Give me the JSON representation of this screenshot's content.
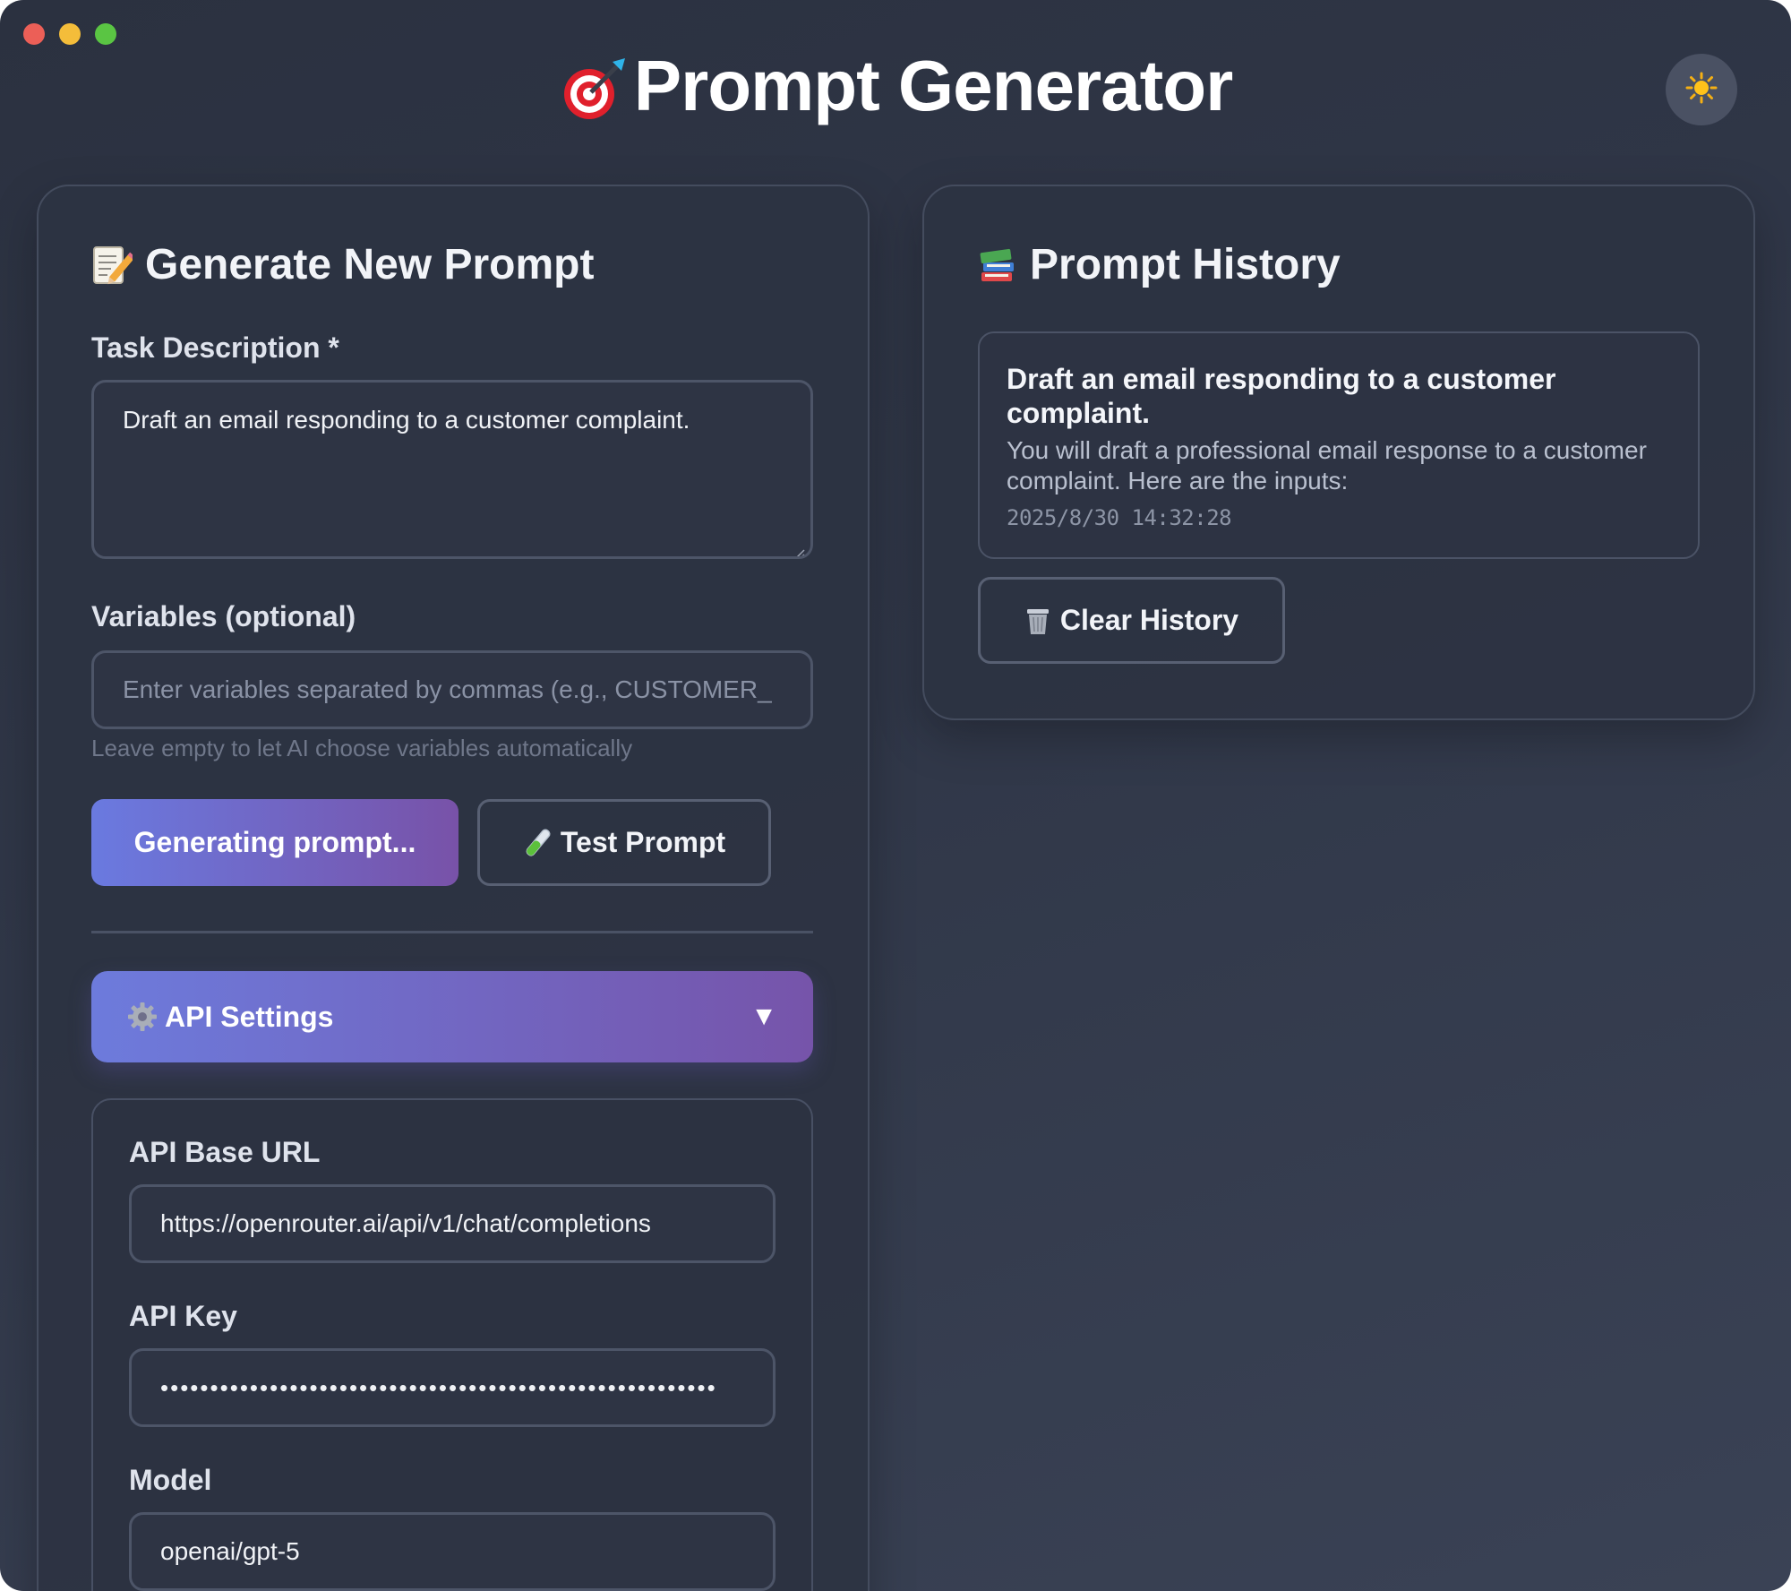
{
  "app": {
    "title": "Prompt Generator",
    "theme_icon": "sun-icon",
    "accent_gradient": [
      "#6a7ae0",
      "#7852a8"
    ]
  },
  "generate": {
    "heading": "Generate New Prompt",
    "heading_icon": "memo-icon",
    "task_label": "Task Description *",
    "task_value": "Draft an email responding to a customer complaint.",
    "variables_label": "Variables (optional)",
    "variables_placeholder": "Enter variables separated by commas (e.g., CUSTOMER_",
    "variables_hint": "Leave empty to let AI choose variables automatically",
    "generate_button": "Generating prompt...",
    "test_button": "Test Prompt",
    "test_icon": "test-tube-icon"
  },
  "api_settings": {
    "heading": "API Settings",
    "icon": "gear-icon",
    "chevron": "▼",
    "base_url_label": "API Base URL",
    "base_url_value": "https://openrouter.ai/api/v1/chat/completions",
    "key_label": "API Key",
    "key_value": "••••••••••••••••••••••••••••••••••••••••••••••••••••••••",
    "model_label": "Model",
    "model_value": "openai/gpt-5"
  },
  "history": {
    "heading": "Prompt History",
    "heading_icon": "books-icon",
    "items": [
      {
        "title": "Draft an email responding to a customer complaint.",
        "preview": "You will draft a professional email response to a customer complaint. Here are the inputs:",
        "timestamp": "2025/8/30 14:32:28"
      }
    ],
    "clear_button": "Clear History",
    "clear_icon": "trash-icon"
  }
}
